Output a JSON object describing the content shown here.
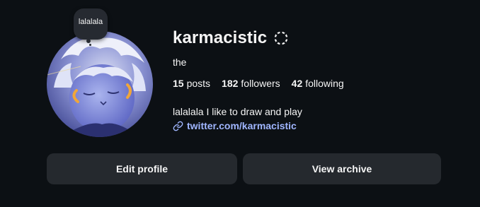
{
  "profile": {
    "username": "karmacistic",
    "full_name": "the",
    "note": "lalalala",
    "bio": "lalalala I like to draw and play",
    "link": "twitter.com/karmacistic",
    "avatar_alt_icon": "avatar-illustration",
    "verified_icon": "threads-icon",
    "link_icon": "link-icon"
  },
  "stats": {
    "posts": {
      "count": "15",
      "label": "posts"
    },
    "followers": {
      "count": "182",
      "label": "followers"
    },
    "following": {
      "count": "42",
      "label": "following"
    }
  },
  "actions": {
    "edit_label": "Edit profile",
    "archive_label": "View archive"
  },
  "colors": {
    "background": "#0c1014",
    "button": "#25292e",
    "link": "#a0b6ff",
    "text": "#f5f5f5"
  }
}
